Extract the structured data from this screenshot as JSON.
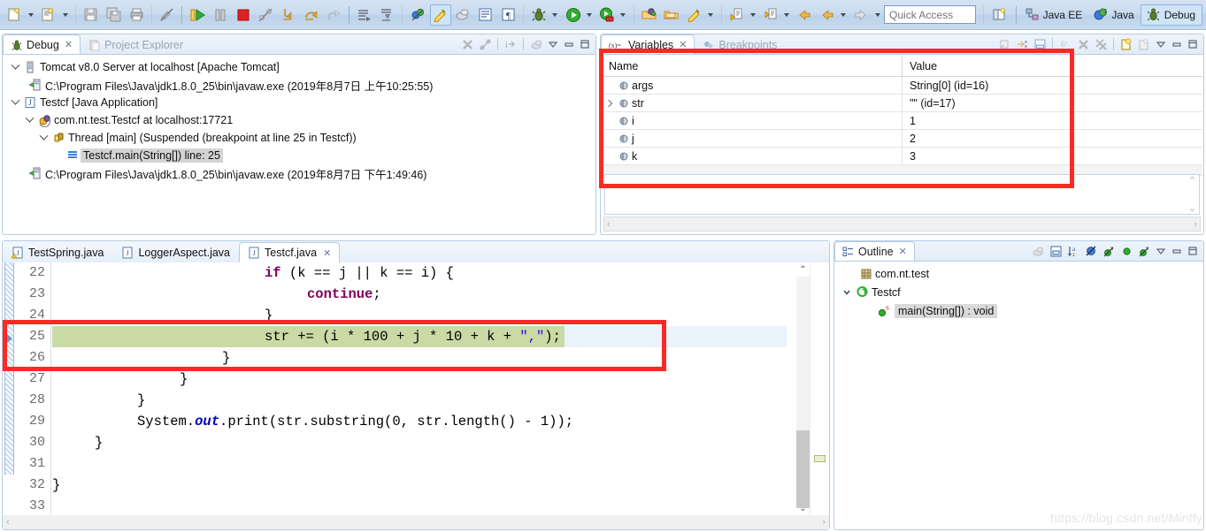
{
  "window": {
    "quick_access_placeholder": "Quick Access"
  },
  "toolbar": {
    "groups": [
      {
        "name": "new",
        "items": [
          "new-wizard-icon",
          "new-dropdown-arrow",
          "new-java-class-icon",
          "new-class-dropdown-arrow"
        ]
      },
      {
        "name": "file",
        "items": [
          "save-icon",
          "save-all-icon",
          "print-icon"
        ]
      },
      {
        "name": "annotate",
        "items": [
          "toggle-annotations-icon"
        ]
      },
      {
        "name": "debug-controls",
        "items": [
          "resume-icon",
          "suspend-icon",
          "terminate-icon",
          "disconnect-icon",
          "step-into-icon",
          "step-over-icon",
          "step-return-icon"
        ]
      },
      {
        "name": "run-menu",
        "items": [
          "run-last-tool-icon",
          "external-tools-icon"
        ]
      },
      {
        "name": "misc",
        "items": [
          "skip-breakpoints-icon",
          "edit-icon",
          "build-icon",
          "toggle-mark-occurrences-icon",
          "show-whitespace-icon",
          "pilcrow-icon"
        ]
      },
      {
        "name": "launch",
        "items": [
          "debug-icon",
          "debug-dropdown-arrow",
          "run-icon",
          "run-dropdown-arrow",
          "run-coverage-icon",
          "coverage-dropdown-arrow"
        ]
      },
      {
        "name": "search",
        "items": [
          "open-type-icon",
          "open-task-icon",
          "search-icon",
          "search-dropdown-arrow"
        ]
      },
      {
        "name": "nav",
        "items": [
          "next-annotation-icon",
          "next-dropdown-arrow",
          "previous-annotation-icon",
          "previous-dropdown-arrow",
          "back-icon",
          "back-dropdown-arrow",
          "forward-icon",
          "forward-dropdown-arrow"
        ]
      }
    ],
    "perspective": {
      "open_perspective_icon": "open-perspective-icon",
      "items": [
        {
          "label": "Java EE",
          "icon": "java-ee-perspective-icon",
          "active": false
        },
        {
          "label": "Java",
          "icon": "java-perspective-icon",
          "active": false
        },
        {
          "label": "Debug",
          "icon": "debug-perspective-icon",
          "active": true
        }
      ]
    }
  },
  "debug_view": {
    "tabs": [
      {
        "label": "Debug",
        "icon": "debug-view-icon",
        "selected": true,
        "closeable": true
      },
      {
        "label": "Project Explorer",
        "icon": "project-explorer-icon",
        "selected": false,
        "closeable": false
      }
    ],
    "toolbar_icons": [
      "remove-all-terminated-icon",
      "disconnect-all-icon",
      "show-qualified-names-icon",
      "view-menu-dots-icon",
      "view-menu-icon",
      "minimize-icon",
      "maximize-icon"
    ],
    "tree": [
      {
        "label": "Tomcat v8.0 Server at localhost [Apache Tomcat]",
        "indent": 0,
        "expanded": true,
        "icon": "server-icon",
        "selected": false
      },
      {
        "label": "C:\\Program Files\\Java\\jdk1.8.0_25\\bin\\javaw.exe (2019年8月7日 上午10:25:55)",
        "indent": 1,
        "expanded": null,
        "icon": "java-process-icon",
        "selected": false
      },
      {
        "label": "Testcf [Java Application]",
        "indent": 0,
        "expanded": true,
        "icon": "java-launch-icon",
        "selected": false
      },
      {
        "label": "com.nt.test.Testcf at localhost:17721",
        "indent": 1,
        "expanded": true,
        "icon": "debug-target-icon",
        "selected": false
      },
      {
        "label": "Thread [main] (Suspended (breakpoint at line 25 in Testcf))",
        "indent": 2,
        "expanded": true,
        "icon": "thread-suspended-icon",
        "selected": false
      },
      {
        "label": "Testcf.main(String[]) line: 25",
        "indent": 3,
        "expanded": null,
        "icon": "stack-frame-icon",
        "selected": true
      },
      {
        "label": "C:\\Program Files\\Java\\jdk1.8.0_25\\bin\\javaw.exe (2019年8月7日 下午1:49:46)",
        "indent": 1,
        "expanded": null,
        "icon": "java-process-icon",
        "selected": false
      }
    ]
  },
  "variables_view": {
    "tabs": [
      {
        "label": "Variables",
        "icon": "variables-icon",
        "selected": true,
        "closeable": true
      },
      {
        "label": "Breakpoints",
        "icon": "breakpoints-icon",
        "selected": false,
        "closeable": false
      }
    ],
    "toolbar_icons": [
      "collapse-all-icon",
      "show-logical-structure-icon",
      "show-detail-pane-icon",
      "show-type-names-icon",
      "remove-selected-icon",
      "remove-all-icon",
      "new-expression-icon",
      "edit-expression-icon",
      "view-menu-icon",
      "minimize-icon",
      "maximize-icon"
    ],
    "columns": [
      "Name",
      "Value"
    ],
    "rows": [
      {
        "name": "args",
        "value": "String[0]  (id=16)",
        "expandable": false,
        "icon": "local-variable-icon"
      },
      {
        "name": "str",
        "value": "\"\" (id=17)",
        "expandable": true,
        "icon": "local-variable-icon"
      },
      {
        "name": "i",
        "value": "1",
        "expandable": false,
        "icon": "local-variable-icon"
      },
      {
        "name": "j",
        "value": "2",
        "expandable": false,
        "icon": "local-variable-icon"
      },
      {
        "name": "k",
        "value": "3",
        "expandable": false,
        "icon": "local-variable-icon"
      }
    ]
  },
  "editor": {
    "tabs": [
      {
        "label": "TestSpring.java",
        "icon": "java-file-warning-icon",
        "selected": false,
        "closeable": false
      },
      {
        "label": "LoggerAspect.java",
        "icon": "java-file-icon",
        "selected": false,
        "closeable": false
      },
      {
        "label": "Testcf.java",
        "icon": "java-file-icon",
        "selected": true,
        "closeable": true
      }
    ],
    "first_line": 22,
    "current_line": 25,
    "lines": [
      {
        "no": "22",
        "indent": 20,
        "current": false,
        "exec": false,
        "tokens": [
          {
            "t": "if",
            "c": "kw"
          },
          {
            "t": " (k == j || k == i) {",
            "c": "blk"
          }
        ]
      },
      {
        "no": "23",
        "indent": 24,
        "current": false,
        "exec": false,
        "tokens": [
          {
            "t": "continue",
            "c": "kw"
          },
          {
            "t": ";",
            "c": "blk"
          }
        ]
      },
      {
        "no": "24",
        "indent": 20,
        "current": false,
        "exec": false,
        "tokens": [
          {
            "t": "}",
            "c": "blk"
          }
        ]
      },
      {
        "no": "25",
        "indent": 20,
        "current": true,
        "exec": true,
        "tokens": [
          {
            "t": "str += (i * ",
            "c": "blk"
          },
          {
            "t": "100",
            "c": "num"
          },
          {
            "t": " + j * ",
            "c": "blk"
          },
          {
            "t": "10",
            "c": "num"
          },
          {
            "t": " + k + ",
            "c": "blk"
          },
          {
            "t": "\",\"",
            "c": "str"
          },
          {
            "t": ");",
            "c": "blk"
          }
        ]
      },
      {
        "no": "26",
        "indent": 16,
        "current": false,
        "exec": false,
        "tokens": [
          {
            "t": "}",
            "c": "blk"
          }
        ]
      },
      {
        "no": "27",
        "indent": 12,
        "current": false,
        "exec": false,
        "tokens": [
          {
            "t": "}",
            "c": "blk"
          }
        ]
      },
      {
        "no": "28",
        "indent": 8,
        "current": false,
        "exec": false,
        "tokens": [
          {
            "t": "}",
            "c": "blk"
          }
        ]
      },
      {
        "no": "29",
        "indent": 8,
        "current": false,
        "exec": false,
        "tokens": [
          {
            "t": "System.",
            "c": "blk"
          },
          {
            "t": "out",
            "c": "fld"
          },
          {
            "t": ".print(str.substring(",
            "c": "blk"
          },
          {
            "t": "0",
            "c": "num"
          },
          {
            "t": ", str.length() - ",
            "c": "blk"
          },
          {
            "t": "1",
            "c": "num"
          },
          {
            "t": "));",
            "c": "blk"
          }
        ]
      },
      {
        "no": "30",
        "indent": 4,
        "current": false,
        "exec": false,
        "tokens": [
          {
            "t": "}",
            "c": "blk"
          }
        ]
      },
      {
        "no": "31",
        "indent": 0,
        "current": false,
        "exec": false,
        "tokens": []
      },
      {
        "no": "32",
        "indent": 0,
        "current": false,
        "exec": false,
        "tokens": [
          {
            "t": "}",
            "c": "blk"
          }
        ]
      },
      {
        "no": "33",
        "indent": 0,
        "current": false,
        "exec": false,
        "tokens": []
      }
    ]
  },
  "outline_view": {
    "tabs": [
      {
        "label": "Outline",
        "icon": "outline-icon",
        "selected": true,
        "closeable": true
      }
    ],
    "toolbar_icons": [
      "focus-on-active-task-icon",
      "collapse-all-icon",
      "sort-alphabetically-icon",
      "hide-fields-icon",
      "hide-static-icon",
      "hide-nonpublic-icon",
      "hide-local-types-icon",
      "view-menu-icon",
      "minimize-icon",
      "maximize-icon"
    ],
    "tree": [
      {
        "label": "com.nt.test",
        "indent": 1,
        "expanded": null,
        "icon": "package-icon",
        "selected": false
      },
      {
        "label": "Testcf",
        "indent": 0,
        "expanded": true,
        "icon": "class-icon",
        "selected": false
      },
      {
        "label": "main(String[]) : void",
        "indent": 2,
        "expanded": null,
        "icon": "method-public-static-icon",
        "selected": true
      }
    ]
  },
  "annotations": {
    "color": "#fc2a24",
    "boxes": [
      {
        "name": "variables-table-highlight"
      },
      {
        "name": "current-line-highlight"
      }
    ]
  },
  "watermark": {
    "text": "https://blog.csdn.net/Minffy"
  }
}
